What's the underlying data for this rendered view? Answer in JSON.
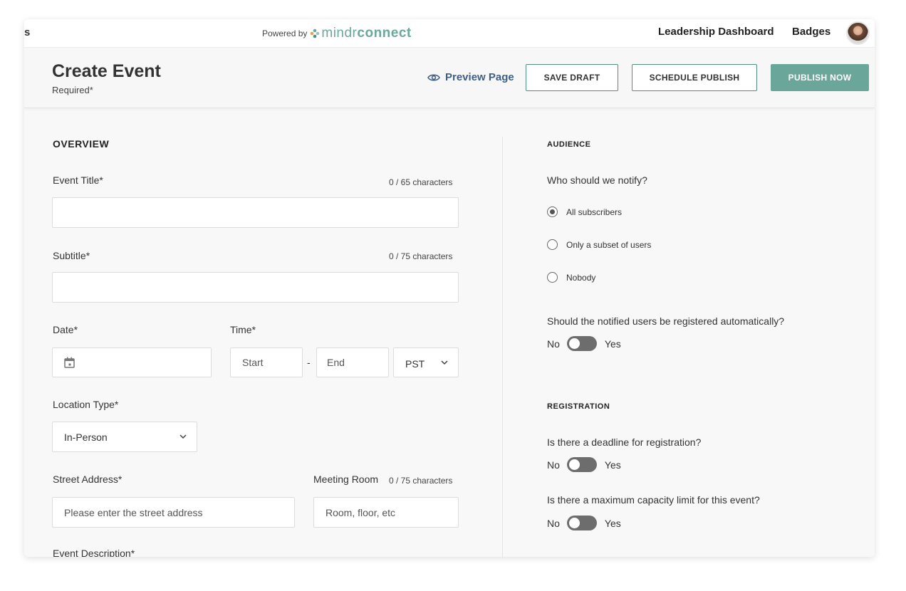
{
  "topbar": {
    "cut_text": "s",
    "powered_by": "Powered by",
    "logo_part1": "mindr",
    "logo_part2": "connect",
    "nav_dashboard": "Leadership Dashboard",
    "nav_badges": "Badges"
  },
  "header": {
    "title": "Create Event",
    "subtitle": "Required*",
    "preview_label": "Preview Page",
    "save_draft": "SAVE DRAFT",
    "schedule_publish": "SCHEDULE PUBLISH",
    "publish_now": "PUBLISH NOW"
  },
  "overview": {
    "heading": "OVERVIEW",
    "event_title_label": "Event Title*",
    "event_title_count": "0 / 65 characters",
    "event_title_value": "",
    "subtitle_label": "Subtitle*",
    "subtitle_count": "0 / 75 characters",
    "subtitle_value": "",
    "date_label": "Date*",
    "time_label": "Time*",
    "time_start": "Start",
    "time_sep": "-",
    "time_end": "End",
    "timezone": "PST",
    "location_type_label": "Location Type*",
    "location_type_value": "In-Person",
    "street_label": "Street Address*",
    "street_placeholder": "Please enter the street address",
    "meeting_room_label": "Meeting Room",
    "meeting_room_count": "0 / 75 characters",
    "meeting_room_placeholder": "Room, floor, etc",
    "description_label": "Event Description*"
  },
  "audience": {
    "heading": "AUDIENCE",
    "question": "Who should we notify?",
    "options": [
      {
        "label": "All subscribers",
        "selected": true
      },
      {
        "label": "Only a subset of users",
        "selected": false
      },
      {
        "label": "Nobody",
        "selected": false
      }
    ],
    "auto_register_question": "Should the notified users be registered automatically?",
    "no": "No",
    "yes": "Yes"
  },
  "registration": {
    "heading": "REGISTRATION",
    "deadline_question": "Is there a deadline for registration?",
    "capacity_question": "Is there a maximum capacity limit for this event?",
    "no": "No",
    "yes": "Yes"
  },
  "colors": {
    "accent": "#6aa79a",
    "link": "#3f5f82",
    "toggle_off": "#6d6d6d"
  },
  "icons": {
    "logo": "mindr-logo-icon",
    "avatar": "user-avatar",
    "preview": "eye-icon",
    "date": "calendar-icon",
    "dropdown": "chevron-down-icon"
  }
}
